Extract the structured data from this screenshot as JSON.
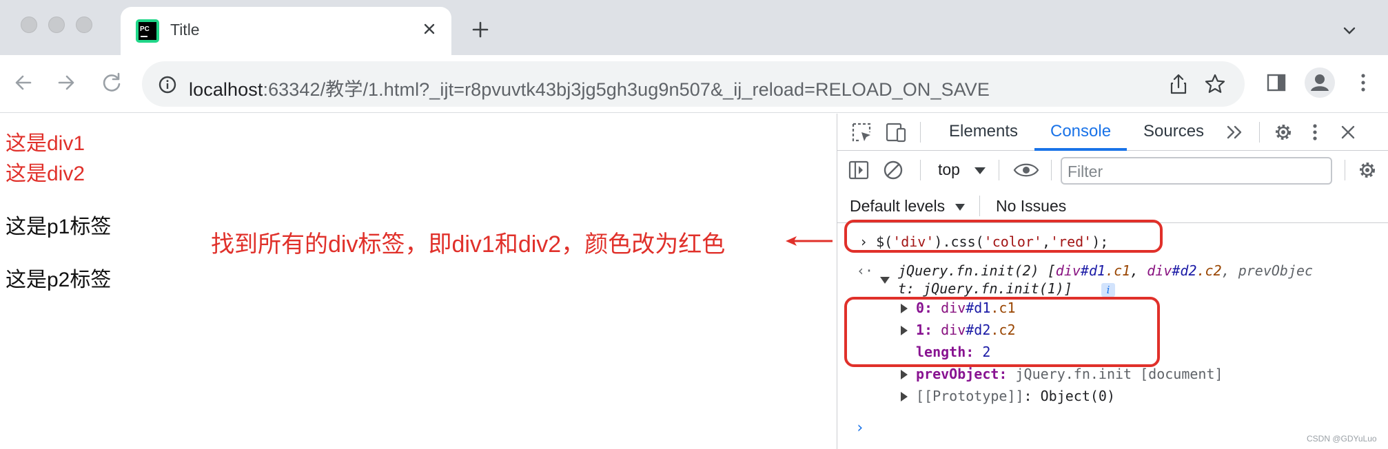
{
  "browser": {
    "tab": {
      "title": "Title",
      "favicon_text": "PC"
    },
    "url": {
      "host": "localhost",
      "rest": ":63342/教学/1.html?_ijt=r8pvuvtk43bj3jg5gh3ug9n507&_ij_reload=RELOAD_ON_SAVE"
    }
  },
  "page": {
    "div1": "这是div1",
    "div2": "这是div2",
    "p1": "这是p1标签",
    "p2": "这是p2标签",
    "annotation": "找到所有的div标签，即div1和div2，颜色改为红色"
  },
  "devtools": {
    "tabs": [
      "Elements",
      "Console",
      "Sources"
    ],
    "active_tab": "Console",
    "context": "top",
    "filter_placeholder": "Filter",
    "levels": "Default levels",
    "issues": "No Issues",
    "console": {
      "input": {
        "p1": "$(",
        "s1": "'div'",
        "p2": ").css(",
        "s2": "'color'",
        "p3": ",",
        "s3": "'red'",
        "p4": ");"
      },
      "result": {
        "head1": "jQuery.fn.init(2) [",
        "el1_tag": "div",
        "el1_id": "#d1",
        "el1_cls": ".c1",
        "sep": ", ",
        "el2_tag": "div",
        "el2_id": "#d2",
        "el2_cls": ".c2",
        "head2": ", prevObjec",
        "line2": "t: jQuery.fn.init(1)]",
        "info": "i"
      },
      "items": [
        {
          "key": "0",
          "tag": "div",
          "id": "#d1",
          "cls": ".c1"
        },
        {
          "key": "1",
          "tag": "div",
          "id": "#d2",
          "cls": ".c2"
        }
      ],
      "length_key": "length",
      "length_value": "2",
      "prev_key": "prevObject",
      "prev_value": "jQuery.fn.init [document]",
      "proto_key": "[[Prototype]]",
      "proto_value": "Object(0)"
    }
  },
  "watermark": "CSDN @GDYuLuo",
  "colors": {
    "accent": "#1a73e8",
    "annotation_red": "#e0302a"
  }
}
